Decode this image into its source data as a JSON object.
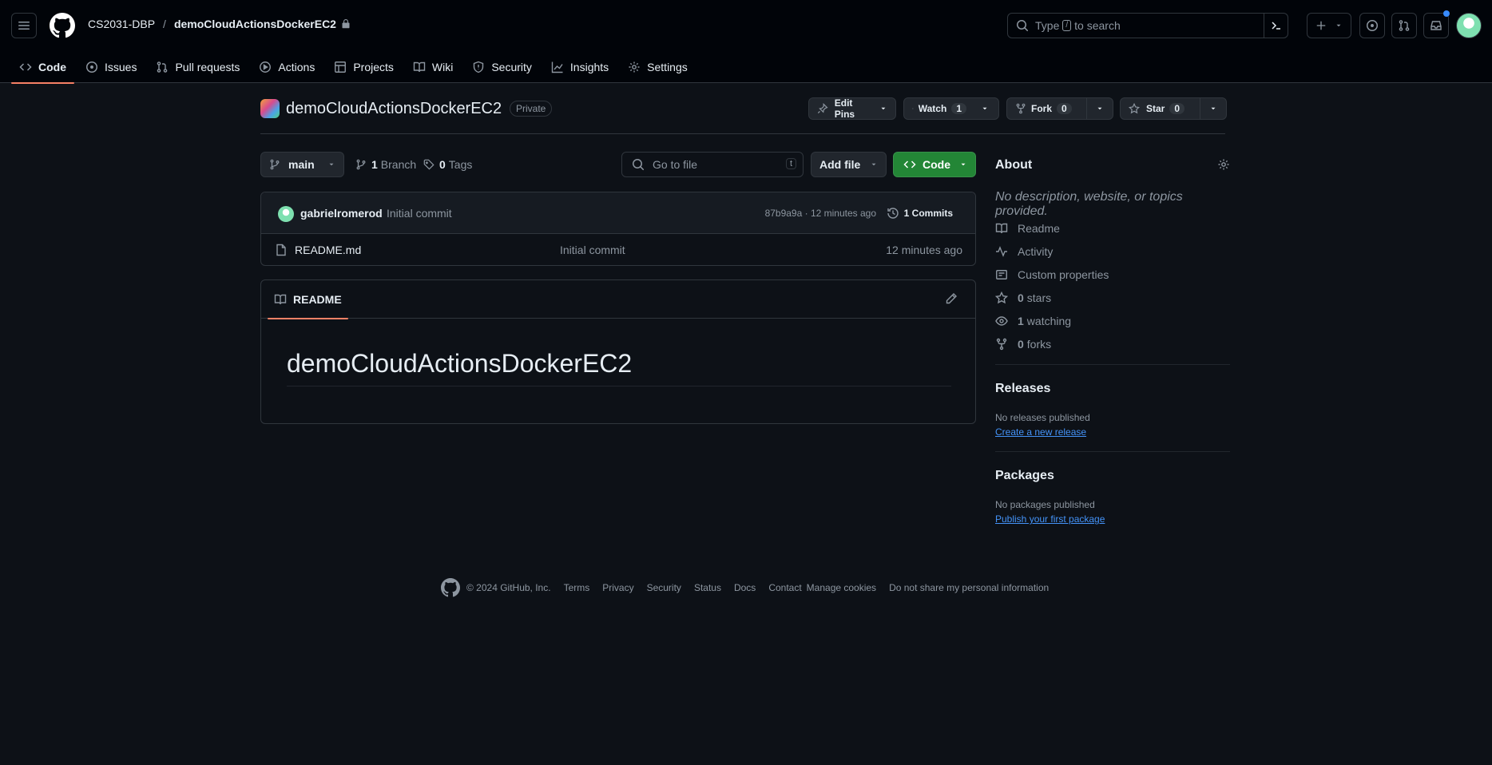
{
  "header": {
    "owner": "CS2031-DBP",
    "separator": "/",
    "repo": "demoCloudActionsDockerEC2",
    "search_prefix": "Type",
    "search_key": "/",
    "search_suffix": "to search"
  },
  "tabs": [
    {
      "label": "Code",
      "icon": "code-icon",
      "active": true
    },
    {
      "label": "Issues",
      "icon": "issue-icon"
    },
    {
      "label": "Pull requests",
      "icon": "pull-request-icon"
    },
    {
      "label": "Actions",
      "icon": "play-icon"
    },
    {
      "label": "Projects",
      "icon": "table-icon"
    },
    {
      "label": "Wiki",
      "icon": "book-icon"
    },
    {
      "label": "Security",
      "icon": "shield-icon"
    },
    {
      "label": "Insights",
      "icon": "graph-icon"
    },
    {
      "label": "Settings",
      "icon": "gear-icon"
    }
  ],
  "repo": {
    "title": "demoCloudActionsDockerEC2",
    "visibility": "Private",
    "edit_pins": "Edit Pins",
    "watch": "Watch",
    "watch_count": "1",
    "fork": "Fork",
    "fork_count": "0",
    "star": "Star",
    "star_count": "0"
  },
  "toolbar": {
    "branch": "main",
    "branch_count": "1",
    "branch_label": "Branch",
    "tag_count": "0",
    "tag_label": "Tags",
    "goto_placeholder": "Go to file",
    "goto_key": "t",
    "add_file": "Add file",
    "code": "Code"
  },
  "commit": {
    "author": "gabrielromerod",
    "message": "Initial commit",
    "hash_time": "87b9a9a · 12 minutes ago",
    "count": "1 Commits"
  },
  "files": [
    {
      "name": "README.md",
      "message": "Initial commit",
      "age": "12 minutes ago"
    }
  ],
  "readme": {
    "tab": "README",
    "heading": "demoCloudActionsDockerEC2"
  },
  "about": {
    "title": "About",
    "description": "No description, website, or topics provided.",
    "items": [
      {
        "label": "Readme",
        "icon": "book-icon"
      },
      {
        "label": "Activity",
        "icon": "pulse-icon"
      },
      {
        "label": "Custom properties",
        "icon": "note-icon"
      },
      {
        "count": "0",
        "label": "stars",
        "icon": "star-icon"
      },
      {
        "count": "1",
        "label": "watching",
        "icon": "eye-icon"
      },
      {
        "count": "0",
        "label": "forks",
        "icon": "fork-icon"
      }
    ]
  },
  "releases": {
    "title": "Releases",
    "empty": "No releases published",
    "link": "Create a new release"
  },
  "packages": {
    "title": "Packages",
    "empty": "No packages published",
    "link": "Publish your first package"
  },
  "footer": {
    "copyright": "© 2024 GitHub, Inc.",
    "links": [
      "Terms",
      "Privacy",
      "Security",
      "Status",
      "Docs",
      "Contact",
      "Manage cookies",
      "Do not share my personal information"
    ]
  },
  "colors": {
    "accent_tab": "#f78166",
    "code_button": "#238636",
    "link": "#4493f8",
    "background": "#0d1117"
  }
}
